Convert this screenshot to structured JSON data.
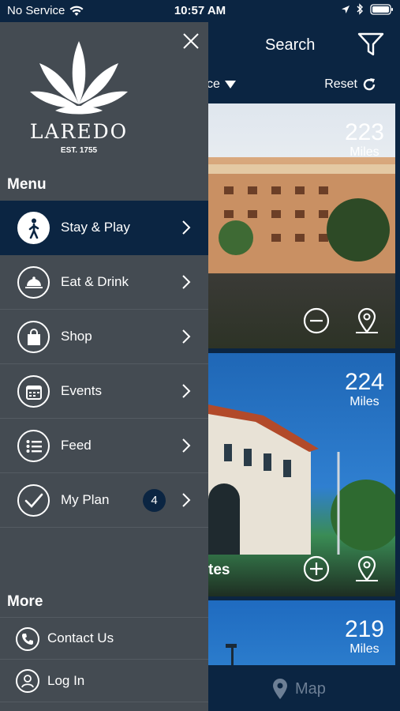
{
  "status_bar": {
    "carrier": "No Service",
    "time": "10:57 AM"
  },
  "header": {
    "search_label": "Search",
    "sort_label": "ce",
    "reset_label": "Reset"
  },
  "cards": [
    {
      "distance": "223",
      "unit": "Miles",
      "name": "",
      "action_icon": "minus-circle-icon"
    },
    {
      "distance": "224",
      "unit": "Miles",
      "name": "tes",
      "action_icon": "plus-circle-icon"
    },
    {
      "distance": "219",
      "unit": "Miles",
      "name": ""
    }
  ],
  "tabbar": {
    "map_label": "Map"
  },
  "drawer": {
    "logo_word": "LAREDO",
    "logo_est": "EST. 1755",
    "menu_title": "Menu",
    "menu_items": [
      {
        "label": "Stay & Play",
        "icon": "walking-person-icon",
        "active": true
      },
      {
        "label": "Eat & Drink",
        "icon": "cloche-icon"
      },
      {
        "label": "Shop",
        "icon": "shopping-bag-icon"
      },
      {
        "label": "Events",
        "icon": "calendar-icon"
      },
      {
        "label": "Feed",
        "icon": "list-icon"
      },
      {
        "label": "My Plan",
        "icon": "checkmark-icon",
        "badge": "4"
      }
    ],
    "more_title": "More",
    "more_items": [
      {
        "label": "Contact Us",
        "icon": "phone-icon"
      },
      {
        "label": "Log In",
        "icon": "user-icon"
      }
    ]
  },
  "colors": {
    "navy": "#0b2542",
    "drawer_bg": "#444b52",
    "divider": "#545b62"
  }
}
